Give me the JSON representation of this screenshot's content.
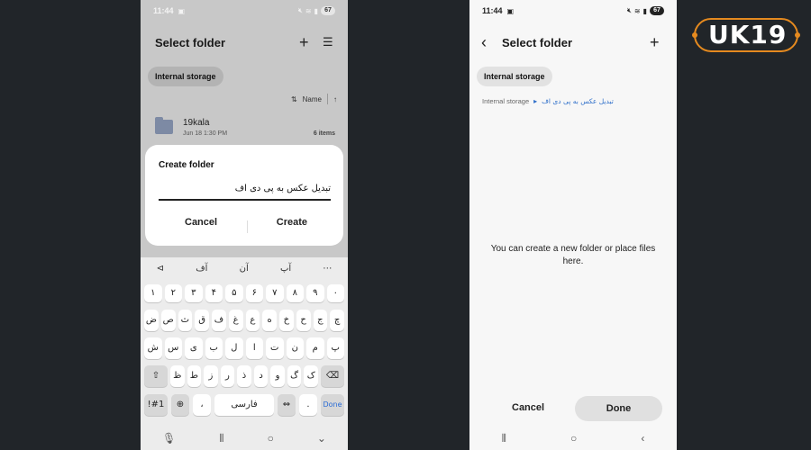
{
  "left_screen": {
    "status": {
      "time": "11:44",
      "battery": "67"
    },
    "title": "Select folder",
    "add_icon": "plus-icon",
    "sort_icon": "sort-lines-icon",
    "storage_chip": "Internal storage",
    "sort": {
      "label": "Name"
    },
    "folder": {
      "name": "19kala",
      "date": "Jun 18 1:30 PM",
      "count": "6 items"
    },
    "dialog": {
      "title": "Create folder",
      "input_value": "تبدیل عکس به پی دی اف",
      "cancel": "Cancel",
      "create": "Create"
    },
    "keyboard": {
      "suggestions": [
        "آف",
        "آن",
        "آپ"
      ],
      "row1": [
        "۱",
        "۲",
        "۳",
        "۴",
        "۵",
        "۶",
        "۷",
        "۸",
        "۹",
        "۰"
      ],
      "row2": [
        "ض",
        "ص",
        "ث",
        "ق",
        "ف",
        "غ",
        "ع",
        "ه",
        "خ",
        "ح",
        "ج",
        "چ"
      ],
      "row3": [
        "ش",
        "س",
        "ی",
        "ب",
        "ل",
        "ا",
        "ت",
        "ن",
        "م",
        "پ"
      ],
      "row4": [
        "ظ",
        "ط",
        "ز",
        "ر",
        "ذ",
        "د",
        "و",
        "گ",
        "ک"
      ],
      "bottom": {
        "symbols": "!#1",
        "comma": "،",
        "space": "فارسی",
        "period": ".",
        "done": "Done"
      }
    }
  },
  "right_screen": {
    "status": {
      "time": "11:44",
      "battery": "67"
    },
    "title": "Select folder",
    "storage_chip": "Internal storage",
    "breadcrumb": {
      "root": "Internal storage",
      "current": "تبدیل عکس به پی دی اف"
    },
    "empty_message": "You can create a new folder or place files here.",
    "cancel": "Cancel",
    "done": "Done"
  },
  "logo": {
    "text": "UK19",
    "accent_color": "#e58a1f"
  }
}
